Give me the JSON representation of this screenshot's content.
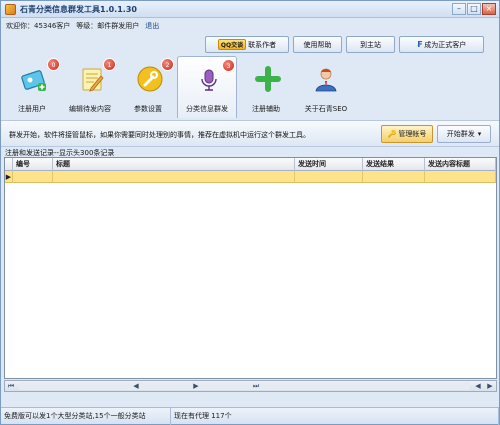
{
  "window": {
    "title": "石青分类信息群发工具1.0.1.30",
    "minimize": "–",
    "maximize": "□",
    "close": "×"
  },
  "userline": {
    "welcome": "欢迎你：45346客户",
    "level": "等级：邮件群发用户",
    "logout": "退出"
  },
  "topbar": {
    "qq_badge": "QQ交谈",
    "contact_author": "联系作者",
    "help": "使用帮助",
    "home": "到主站",
    "become_customer": "成为正式客户"
  },
  "nav": {
    "items": [
      {
        "label": "注册用户",
        "badge": "0",
        "icon": "user-card-icon"
      },
      {
        "label": "编辑待发内容",
        "badge": "1",
        "icon": "edit-note-icon"
      },
      {
        "label": "参数设置",
        "badge": "2",
        "icon": "wrench-icon"
      },
      {
        "label": "分类信息群发",
        "badge": "3",
        "icon": "microphone-icon",
        "active": true
      },
      {
        "label": "注册辅助",
        "icon": "plus-icon"
      },
      {
        "label": "关于石青SEO",
        "icon": "person-icon"
      }
    ]
  },
  "toolbar": {
    "info": "群发开始，软件将接管鼠标，如果你需要同时处理别的事情，推荐在虚拟机中运行这个群发工具。",
    "manage_accounts": "管理帐号",
    "start_send": "开始群发"
  },
  "records": {
    "title": "注册和发送记录--显示头300条记录",
    "columns": [
      "编号",
      "标题",
      "发送时间",
      "发送结果",
      "发送内容标题"
    ],
    "row_marker": "▶"
  },
  "scrollbar": {
    "first": "⏮",
    "prev": "◀",
    "next": "▶",
    "last": "⏭",
    "left": "◀",
    "right": "▶"
  },
  "status": {
    "left": "免费版可以发1个大型分类站,15个一般分类站",
    "right": "现在有代理 117个"
  },
  "colors": {
    "accent": "#1b3f70",
    "selected_row": "#ffe38a",
    "badge": "#c8271a"
  }
}
